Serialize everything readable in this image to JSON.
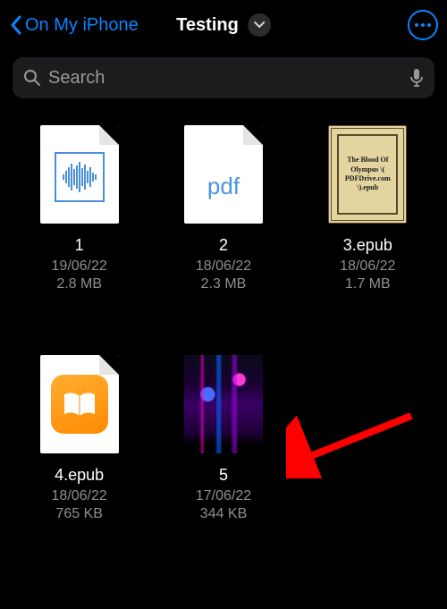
{
  "header": {
    "back_label": "On My iPhone",
    "title": "Testing"
  },
  "search": {
    "placeholder": "Search"
  },
  "cover_text": "The Blood Of Olympus \\( PDFDrive.com \\).epub",
  "files": [
    {
      "name": "1",
      "date": "19/06/22",
      "size": "2.8 MB"
    },
    {
      "name": "2",
      "date": "18/06/22",
      "size": "2.3 MB"
    },
    {
      "name": "3.epub",
      "date": "18/06/22",
      "size": "1.7 MB"
    },
    {
      "name": "4.epub",
      "date": "18/06/22",
      "size": "765 KB"
    },
    {
      "name": "5",
      "date": "17/06/22",
      "size": "344 KB"
    }
  ]
}
